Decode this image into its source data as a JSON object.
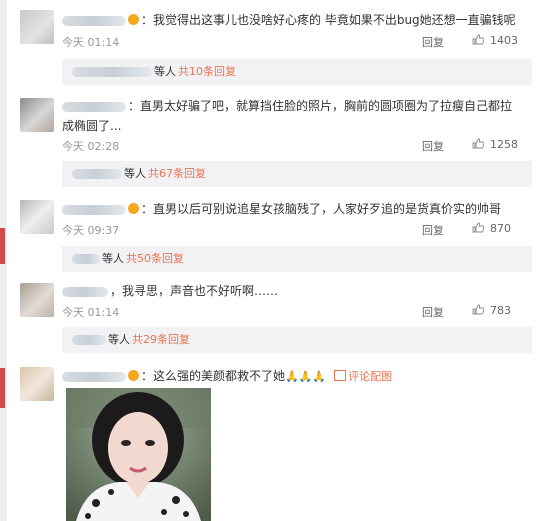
{
  "comments": [
    {
      "text": "我觉得出这事儿也没啥好心疼的 毕竟如果不出bug她还想一直骗钱呢",
      "time": "今天 01:14",
      "reply": "回复",
      "likes": "1403",
      "thread": {
        "who": "等人",
        "link": "共10条回复"
      }
    },
    {
      "text_line1": "直男太好骗了吧，就算挡住脸的照片，胸前的圆项圈为了拉瘦自己都拉",
      "text_line2": "成椭圆了...",
      "time": "今天 02:28",
      "reply": "回复",
      "likes": "1258",
      "thread": {
        "who": "等人",
        "link": "共67条回复"
      }
    },
    {
      "text": "直男以后可别说追星女孩脑残了，人家好歹追的是货真价实的帅哥",
      "time": "今天 09:37",
      "reply": "回复",
      "likes": "870",
      "thread": {
        "who": "等人",
        "link": "共50条回复"
      }
    },
    {
      "text": "我寻思，声音也不好听啊……",
      "time": "今天 01:14",
      "reply": "回复",
      "likes": "783",
      "thread": {
        "who": "等人",
        "link": "共29条回复"
      }
    },
    {
      "text": "这么强的美颜都救不了她",
      "emoji": "🙏🙏🙏",
      "pic_link": "评论配图"
    }
  ],
  "colors": {
    "link": "#eb7350",
    "meta": "#999999",
    "reply_bg": "#f2f2f5"
  },
  "icons": [
    "thumbs-up-icon",
    "vip-badge-icon",
    "image-icon"
  ]
}
